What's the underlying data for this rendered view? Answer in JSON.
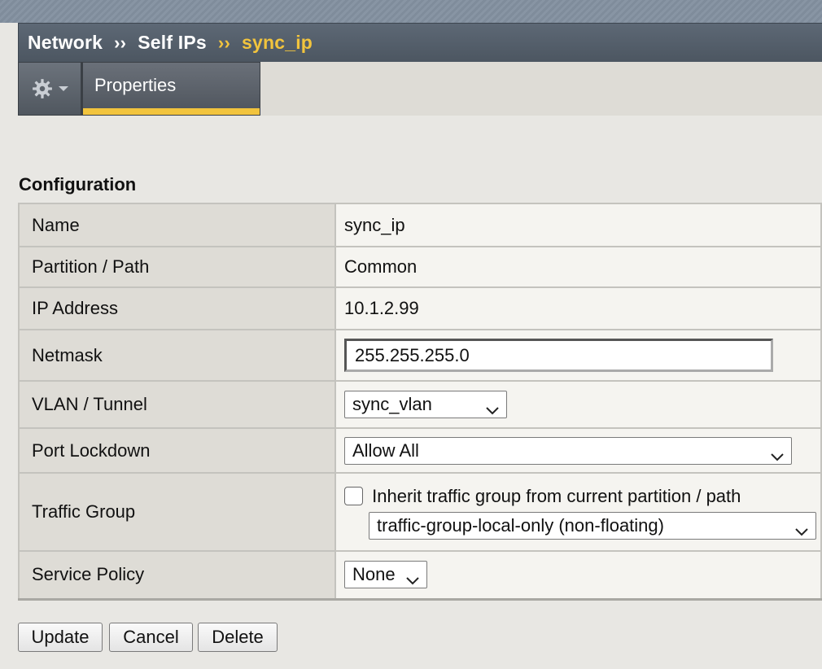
{
  "breadcrumb": {
    "items": [
      "Network",
      "Self IPs",
      "sync_ip"
    ],
    "separator": "››"
  },
  "tabs": {
    "properties_label": "Properties"
  },
  "section": {
    "title": "Configuration"
  },
  "form": {
    "name": {
      "label": "Name",
      "value": "sync_ip"
    },
    "partition": {
      "label": "Partition / Path",
      "value": "Common"
    },
    "ip_address": {
      "label": "IP Address",
      "value": "10.1.2.99"
    },
    "netmask": {
      "label": "Netmask",
      "value": "255.255.255.0"
    },
    "vlan": {
      "label": "VLAN / Tunnel",
      "selected": "sync_vlan"
    },
    "port_lockdown": {
      "label": "Port Lockdown",
      "selected": "Allow All"
    },
    "traffic_group": {
      "label": "Traffic Group",
      "inherit_label": "Inherit traffic group from current partition / path",
      "inherit_checked": false,
      "selected": "traffic-group-local-only (non-floating)"
    },
    "service_policy": {
      "label": "Service Policy",
      "selected": "None"
    }
  },
  "buttons": {
    "update": "Update",
    "cancel": "Cancel",
    "delete": "Delete"
  },
  "icons": {
    "gear": "gear-icon",
    "dropdown_arrow": "chevron-down-icon"
  },
  "colors": {
    "header_bg": "#52606d",
    "accent": "#f2c43d",
    "page_bg": "#e8e7e3",
    "label_cell_bg": "#dedcd6",
    "value_cell_bg": "#f5f4f0"
  }
}
